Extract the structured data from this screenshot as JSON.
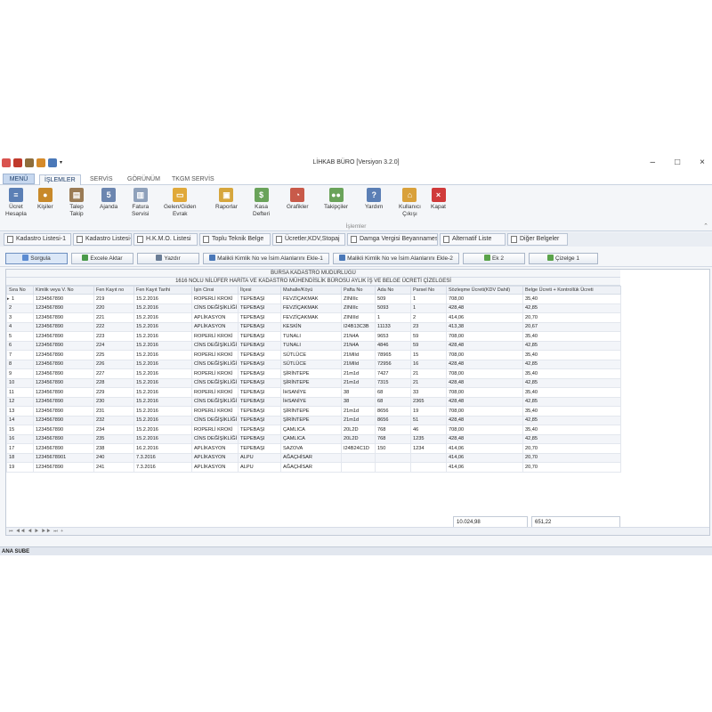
{
  "window": {
    "title": "LİHKAB BÜRO [Versiyon 3.2.0]",
    "controls": [
      "–",
      "□",
      "×"
    ]
  },
  "ribbon_tabs": [
    "MENÜ",
    "İŞLEMLER",
    "SERVİS",
    "GÖRÜNÜM",
    "TKGM SERVİS"
  ],
  "ribbon": {
    "group_label": "İşlemler",
    "buttons": [
      {
        "label": "Ücret\nHesapla",
        "icon": "calculator-icon",
        "color": "#5b7fb5"
      },
      {
        "label": "Kişiler",
        "icon": "person-icon",
        "color": "#c8892a"
      },
      {
        "label": "Talep\nTakip",
        "icon": "clipboard-icon",
        "color": "#9a7b55"
      },
      {
        "label": "Ajanda",
        "icon": "calendar-icon",
        "color": "#6c86b0"
      },
      {
        "label": "Fatura\nServisi",
        "icon": "invoice-icon",
        "color": "#8fa1bb"
      },
      {
        "label": "Gelen/Giden\nEvrak",
        "icon": "folder-icon",
        "color": "#e0a93a"
      },
      {
        "label": "Raporlar",
        "icon": "report-icon",
        "color": "#d6a63d"
      },
      {
        "label": "Kasa\nDefteri",
        "icon": "cashbook-icon",
        "color": "#6aa35a"
      },
      {
        "label": "Grafikler",
        "icon": "pie-chart-icon",
        "color": "#c85a4a"
      },
      {
        "label": "Takipçiler",
        "icon": "group-icon",
        "color": "#6aa35a"
      },
      {
        "label": "Yardım",
        "icon": "help-icon",
        "color": "#5b7fb5"
      },
      {
        "label": "Kullanıcı\nÇıkışı",
        "icon": "logout-icon",
        "color": "#d9a13b"
      },
      {
        "label": "Kapat",
        "icon": "close-icon",
        "color": "#d03b3b"
      }
    ]
  },
  "doc_tabs": [
    "Kadastro Listesi-1",
    "Kadastro Listesi-2",
    "H.K.M.O. Listesi",
    "Toplu Teknik Belge",
    "Ücretler,KDV,Stopaj",
    "Damga Vergisi Beyannamesi",
    "Alternatif Liste",
    "Diğer Belgeler"
  ],
  "toolbar": {
    "buttons": [
      "Sorgula",
      "Excele Aktar",
      "Yazdır",
      "Malikli Kimlik No  ve İsim Alanlarını Ekle-1",
      "Malikli Kimlik No  ve İsim Alanlarını Ekle-2",
      "Ek 2",
      "Çizelge 1"
    ]
  },
  "grid": {
    "header_line1": "BURSA KADASTRO MÜDÜRLÜĞÜ",
    "header_line2": "1616 NOLU NİLÜFER HARİTA VE KADASTRO MÜHENDİSLİK BÜROSU AYLIK İŞ VE BELGE ÜCRETİ ÇİZELGESİ",
    "columns": [
      "Sıra No",
      "Kimlik veya V. No",
      "Fen Kayıt no",
      "Fen Kayıt Tarihi",
      "İşin Cinsi",
      "İlçesi",
      "Mahalle/Köyü",
      "Pafta No",
      "Ada No",
      "Parsel No",
      "Sözleşme Ücreti(KDV Dahil)",
      "Belge Ücreti + Kontrollük Ücreti"
    ],
    "rows": [
      [
        "1",
        "1234567890",
        "219",
        "15.2.2016",
        "ROPERLİ KROKİ",
        "TEPEBAŞI",
        "FEVZİÇAKMAK",
        "ZINIIIc",
        "509",
        "1",
        "708,00",
        "35,40"
      ],
      [
        "2",
        "1234567890",
        "220",
        "15.2.2016",
        "CİNS DEĞİŞİKLİĞİ",
        "TEPEBAŞI",
        "FEVZİÇAKMAK",
        "ZINIIIc",
        "5093",
        "1",
        "428,48",
        "42,85"
      ],
      [
        "3",
        "1234567890",
        "221",
        "15.2.2016",
        "APLİKASYON",
        "TEPEBAŞI",
        "FEVZİÇAKMAK",
        "ZINIIId",
        "1",
        "2",
        "414,06",
        "20,70"
      ],
      [
        "4",
        "1234567890",
        "222",
        "15.2.2016",
        "APLİKASYON",
        "TEPEBAŞI",
        "KESKİN",
        "I24B13C3B",
        "11133",
        "23",
        "413,38",
        "20,67"
      ],
      [
        "5",
        "1234567890",
        "223",
        "15.2.2016",
        "ROPERLİ KROKİ",
        "TEPEBAŞI",
        "TUNALI",
        "21N4A",
        "9653",
        "59",
        "708,00",
        "35,40"
      ],
      [
        "6",
        "1234567890",
        "224",
        "15.2.2016",
        "CİNS DEĞİŞİKLİĞİ",
        "TEPEBAŞI",
        "TUNALI",
        "21N4A",
        "4846",
        "59",
        "428,48",
        "42,85"
      ],
      [
        "7",
        "1234567890",
        "225",
        "15.2.2016",
        "ROPERLİ KROKİ",
        "TEPEBAŞI",
        "SÜTLÜCE",
        "21MIId",
        "78965",
        "15",
        "708,00",
        "35,40"
      ],
      [
        "8",
        "1234567890",
        "226",
        "15.2.2016",
        "CİNS DEĞİŞİKLİĞİ",
        "TEPEBAŞI",
        "SÜTLÜCE",
        "21MIId",
        "72956",
        "16",
        "428,48",
        "42,85"
      ],
      [
        "9",
        "1234567890",
        "227",
        "15.2.2016",
        "ROPERLİ KROKİ",
        "TEPEBAŞI",
        "ŞİRİNTEPE",
        "21m1d",
        "7427",
        "21",
        "708,00",
        "35,40"
      ],
      [
        "10",
        "1234567890",
        "228",
        "15.2.2016",
        "CİNS DEĞİŞİKLİĞİ",
        "TEPEBAŞI",
        "ŞİRİNTEPE",
        "21m1d",
        "7315",
        "21",
        "428,48",
        "42,85"
      ],
      [
        "11",
        "1234567890",
        "229",
        "15.2.2016",
        "ROPERLİ KROKİ",
        "TEPEBAŞI",
        "İHSANİYE",
        "38",
        "68",
        "33",
        "708,00",
        "35,40"
      ],
      [
        "12",
        "1234567890",
        "230",
        "15.2.2016",
        "CİNS DEĞİŞİKLİĞİ",
        "TEPEBAŞI",
        "İHSANİYE",
        "38",
        "68",
        "2365",
        "428,48",
        "42,85"
      ],
      [
        "13",
        "1234567890",
        "231",
        "15.2.2016",
        "ROPERLİ KROKİ",
        "TEPEBAŞI",
        "ŞİRİNTEPE",
        "21m1d",
        "8656",
        "19",
        "708,00",
        "35,40"
      ],
      [
        "14",
        "1234567890",
        "232",
        "15.2.2016",
        "CİNS DEĞİŞİKLİĞİ",
        "TEPEBAŞI",
        "ŞİRİNTEPE",
        "21m1d",
        "8656",
        "51",
        "428,48",
        "42,85"
      ],
      [
        "15",
        "1234567890",
        "234",
        "15.2.2016",
        "ROPERLİ KROKİ",
        "TEPEBAŞI",
        "ÇAMLICA",
        "20L2D",
        "768",
        "46",
        "708,00",
        "35,40"
      ],
      [
        "16",
        "1234567890",
        "235",
        "15.2.2016",
        "CİNS DEĞİŞİKLİĞİ",
        "TEPEBAŞI",
        "ÇAMLICA",
        "20L2D",
        "768",
        "1235",
        "428,48",
        "42,85"
      ],
      [
        "17",
        "1234567890",
        "238",
        "16.2.2016",
        "APLİKASYON",
        "TEPEBAŞI",
        "SAZOVA",
        "I24B24C1D",
        "150",
        "1234",
        "414,06",
        "20,70"
      ],
      [
        "18",
        "12345678901",
        "240",
        "7.3.2016",
        "APLİKASYON",
        "ALPU",
        "AĞAÇHİSAR",
        "",
        "",
        "",
        "414,06",
        "20,70"
      ],
      [
        "19",
        "1234567890",
        "241",
        "7.3.2016",
        "APLİKASYON",
        "ALPU",
        "AĞAÇHİSAR",
        "",
        "",
        "",
        "414,06",
        "20,70"
      ]
    ],
    "total_contract": "10.024,98",
    "total_fee": "651,22",
    "nav": "⏮ ◀◀ ◀ ▶ ▶▶ ⏭ +"
  },
  "status_bar": "ANA SUBE"
}
